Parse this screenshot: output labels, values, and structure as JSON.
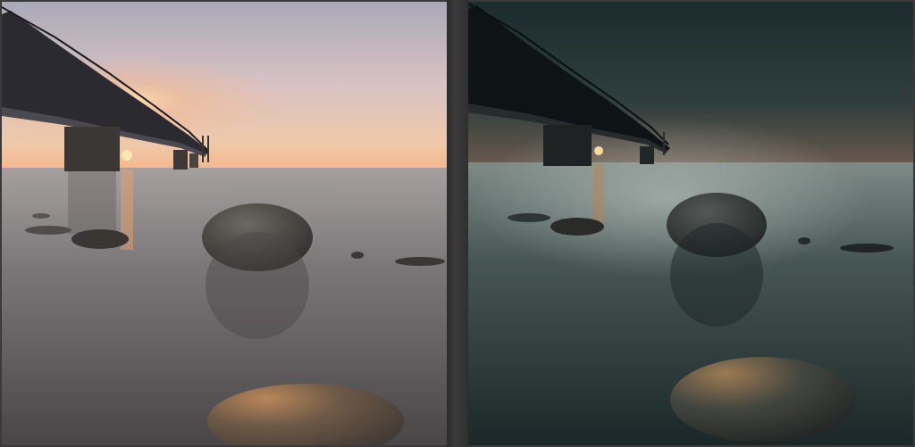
{
  "view": {
    "mode": "before-after",
    "panels": [
      {
        "id": "before",
        "tone": "warm-sunrise"
      },
      {
        "id": "after",
        "tone": "teal-dark"
      }
    ]
  },
  "colors": {
    "frame": "#3a3a3a",
    "before_sky_top": "#b7b6c1",
    "before_sky_horizon": "#f2c09a",
    "before_water": "#6f6c70",
    "after_sky_top": "#1f3335",
    "after_sky_horizon": "#5a5a52",
    "after_water": "#2a3a3b",
    "sun": "#ffd08a"
  },
  "scene": {
    "subject": "bridge-over-sea-with-rocks",
    "elements": [
      "bridge",
      "bridge-pillar",
      "sun",
      "horizon",
      "large-rock",
      "foreground-rock",
      "small-rocks"
    ]
  }
}
